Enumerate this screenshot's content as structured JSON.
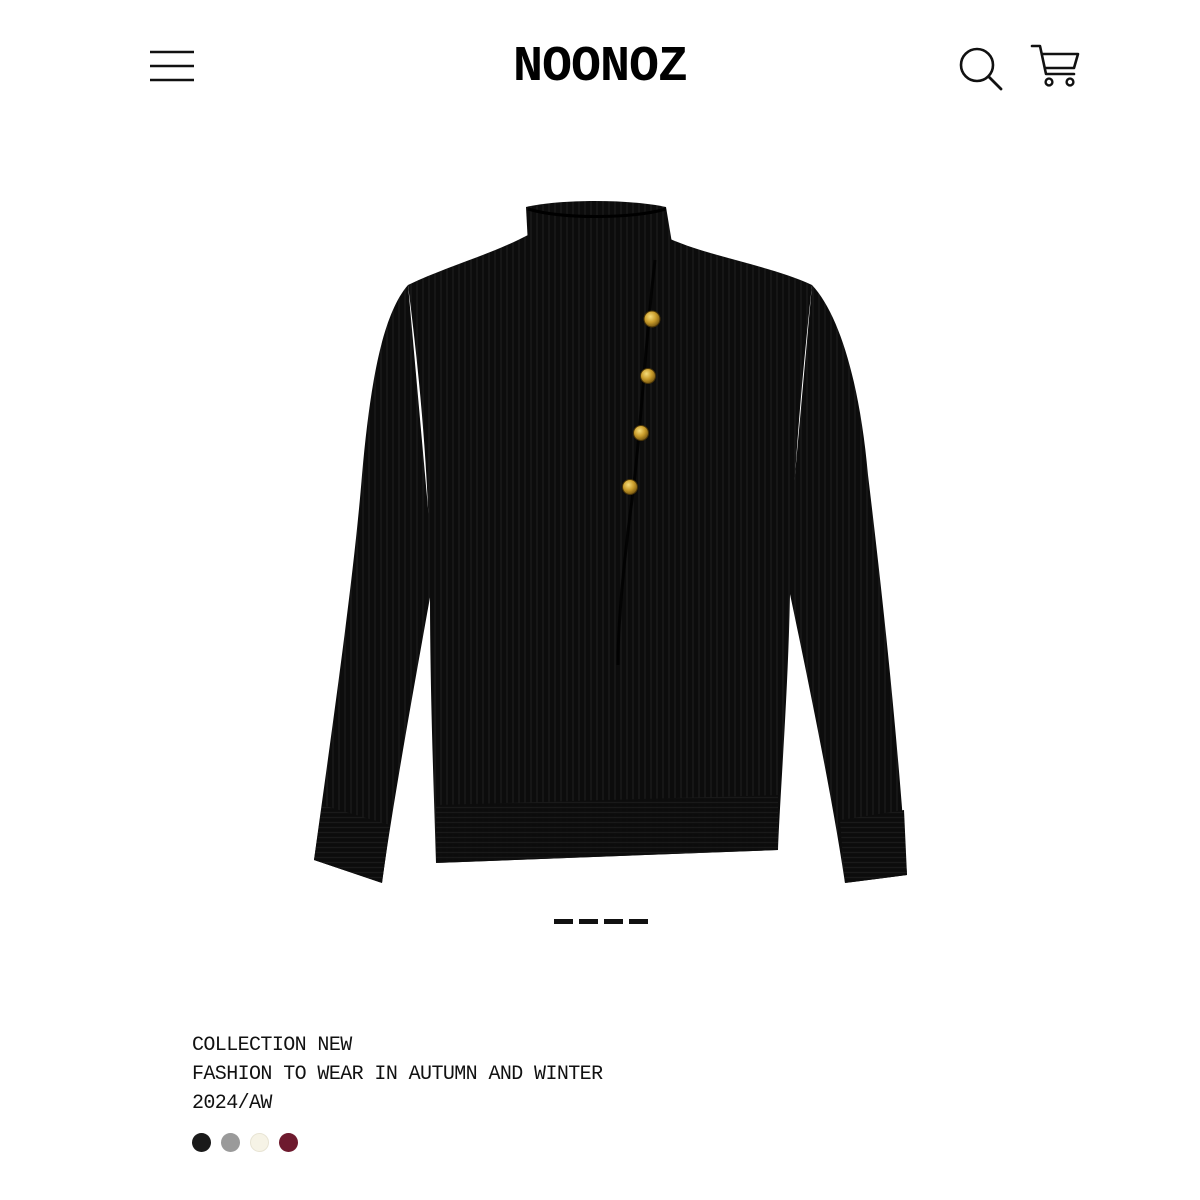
{
  "header": {
    "brand": "NOONOZ",
    "menu_icon": "hamburger-menu-icon",
    "search_icon": "search-icon",
    "cart_icon": "shopping-cart-icon"
  },
  "product": {
    "image_description_icon": "black-knit-sweater-image",
    "colors": {
      "sweater": "#0b0b0b",
      "button": "#c9a02f"
    }
  },
  "carousel": {
    "slides": 4,
    "active_color": "#111111"
  },
  "info": {
    "line1": "COLLECTION NEW",
    "line2": "FASHION TO WEAR IN AUTUMN AND WINTER",
    "line3": "2024/AW"
  },
  "swatches": [
    {
      "name": "black",
      "color": "#1a1a1a"
    },
    {
      "name": "grey",
      "color": "#9a9a9a"
    },
    {
      "name": "cream",
      "color": "#f6f3e6"
    },
    {
      "name": "burgundy",
      "color": "#6e1a2e"
    }
  ]
}
